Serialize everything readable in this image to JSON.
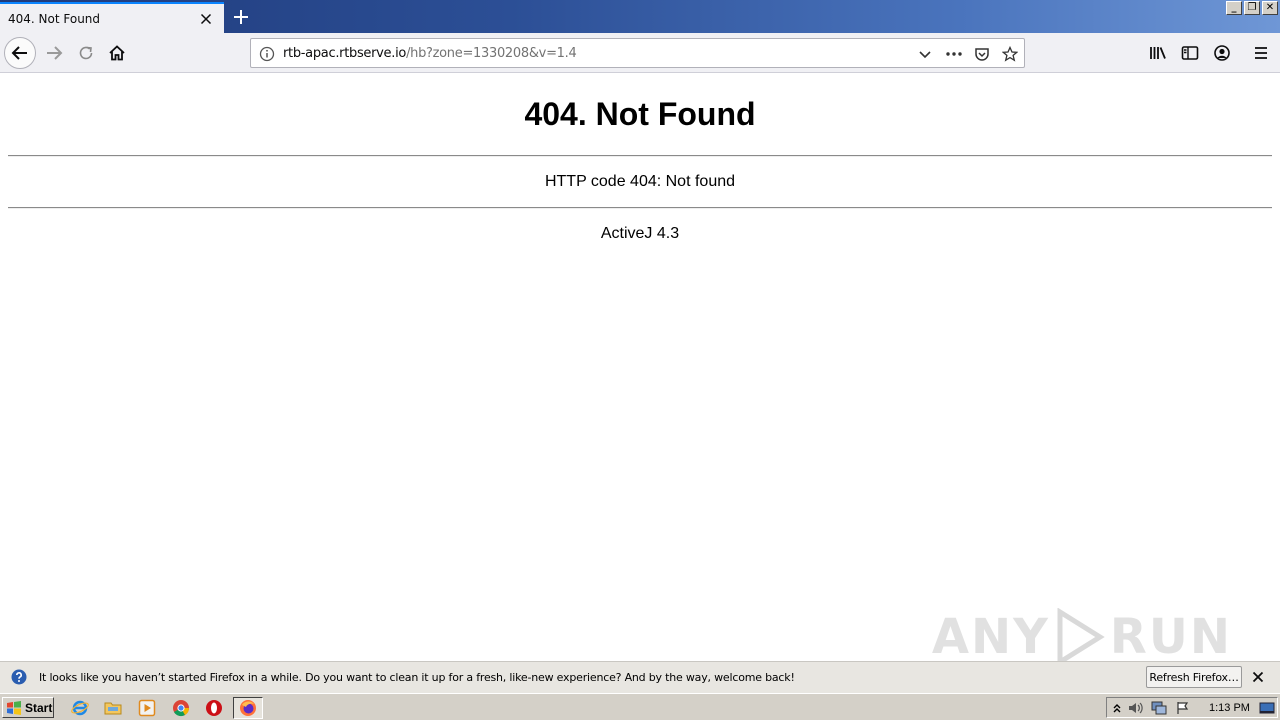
{
  "browser": {
    "tab": {
      "title": "404. Not Found"
    },
    "url": {
      "host": "rtb-apac.rtbserve.io",
      "path": "/hb?zone=1330208&v=1.4"
    },
    "icons": [
      "back-arrow-icon",
      "forward-arrow-icon",
      "reload-icon",
      "home-icon",
      "info-icon",
      "dropdown-chevron-icon",
      "more-icon",
      "pocket-icon",
      "star-icon",
      "library-icon",
      "sidebar-icon",
      "account-icon",
      "menu-icon"
    ]
  },
  "window": {
    "minimize": "_",
    "restore": "❐",
    "close": "✕"
  },
  "page": {
    "heading": "404. Not Found",
    "message": "HTTP code 404: Not found",
    "footer": "ActiveJ 4.3"
  },
  "watermark": {
    "left": "ANY",
    "right": "RUN"
  },
  "notification": {
    "message": "It looks like you haven’t started Firefox in a while. Do you want to clean it up for a fresh, like-new experience? And by the way, welcome back!",
    "button": "Refresh Firefox…"
  },
  "taskbar": {
    "start": "Start",
    "apps": [
      "internet-explorer-icon",
      "file-explorer-icon",
      "media-player-icon",
      "chrome-icon",
      "opera-icon",
      "firefox-icon"
    ],
    "clock": "1:13 PM"
  },
  "colors": {
    "accent": "#0a84ff",
    "titlebar": "#2c4f96",
    "taskbar": "#d4d0c8"
  }
}
